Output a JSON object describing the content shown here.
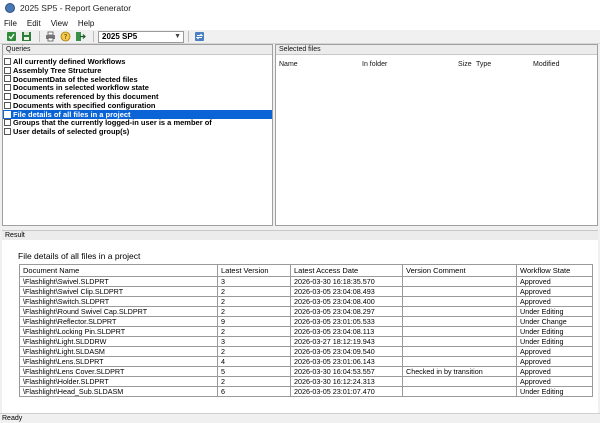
{
  "window": {
    "title": "2025 SP5 - Report Generator"
  },
  "menu": [
    "File",
    "Edit",
    "View",
    "Help"
  ],
  "toolbar": {
    "vault": "2025 SP5"
  },
  "queries": {
    "header": "Queries",
    "items": [
      "All currently defined Workflows",
      "Assembly Tree Structure",
      "DocumentData of the selected files",
      "Documents in selected workflow state",
      "Documents referenced by this document",
      "Documents with specified configuration",
      "File details of all files in a project",
      "Groups that the currently logged-in user is a member of",
      "User details of selected group(s)"
    ],
    "selected_index": 6
  },
  "selected_files": {
    "header": "Selected files",
    "columns": [
      "Name",
      "In folder",
      "Size",
      "Type",
      "Modified"
    ]
  },
  "result": {
    "header": "Result",
    "title": "File details of all files in a project",
    "columns": [
      "Document Name",
      "Latest Version",
      "Latest Access Date",
      "Version Comment",
      "Workflow State"
    ],
    "rows": [
      [
        "\\Flashlight\\Swivel.SLDPRT",
        "3",
        "2026-03-30 16:18:35.570",
        "",
        "Approved"
      ],
      [
        "\\Flashlight\\Swivel Clip.SLDPRT",
        "2",
        "2026-03-05 23:04:08.493",
        "",
        "Approved"
      ],
      [
        "\\Flashlight\\Switch.SLDPRT",
        "2",
        "2026-03-05 23:04:08.400",
        "",
        "Approved"
      ],
      [
        "\\Flashlight\\Round Swivel Cap.SLDPRT",
        "2",
        "2026-03-05 23:04:08.297",
        "",
        "Under Editing"
      ],
      [
        "\\Flashlight\\Reflector.SLDPRT",
        "9",
        "2026-03-05 23:01:05.533",
        "",
        "Under Change"
      ],
      [
        "\\Flashlight\\Locking Pin.SLDPRT",
        "2",
        "2026-03-05 23:04:08.113",
        "",
        "Under Editing"
      ],
      [
        "\\Flashlight\\Light.SLDDRW",
        "3",
        "2026-03-27 18:12:19.943",
        "",
        "Under Editing"
      ],
      [
        "\\Flashlight\\Light.SLDASM",
        "2",
        "2026-03-05 23:04:09.540",
        "",
        "Approved"
      ],
      [
        "\\Flashlight\\Lens.SLDPRT",
        "4",
        "2026-03-05 23:01:06.143",
        "",
        "Approved"
      ],
      [
        "\\Flashlight\\Lens Cover.SLDPRT",
        "5",
        "2026-03-30 16:04:53.557",
        "Checked in by transition",
        "Approved"
      ],
      [
        "\\Flashlight\\Holder.SLDPRT",
        "2",
        "2026-03-30 16:12:24.313",
        "",
        "Approved"
      ],
      [
        "\\Flashlight\\Head_Sub.SLDASM",
        "6",
        "2026-03-05 23:01:07.470",
        "",
        "Under Editing"
      ]
    ]
  },
  "status": "Ready"
}
